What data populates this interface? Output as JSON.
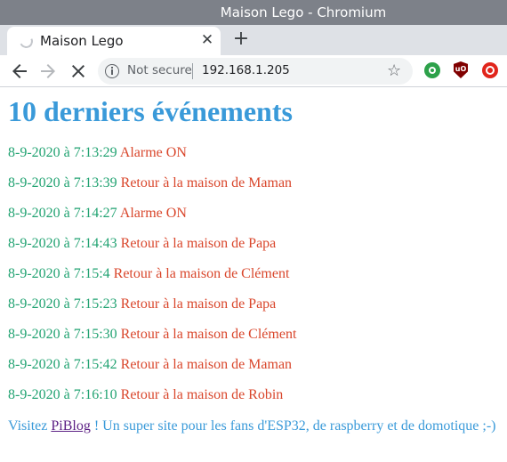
{
  "window": {
    "title": "Maison Lego - Chromium"
  },
  "tab": {
    "title": "Maison Lego",
    "close_glyph": "✕",
    "new_tab_glyph": "+"
  },
  "toolbar": {
    "back_icon": "arrow-left-icon",
    "forward_icon": "arrow-right-icon",
    "stop_icon": "stop-icon",
    "security_label": "Not secure",
    "url": "192.168.1.205",
    "bookmark_glyph": "☆",
    "extensions": [
      "green-circle-extension",
      "ublock-origin-extension",
      "red-circle-extension"
    ]
  },
  "page": {
    "title": "10 derniers événements",
    "events": [
      {
        "timestamp": "8-9-2020 à 7:13:29",
        "message": "Alarme ON"
      },
      {
        "timestamp": "8-9-2020 à 7:13:39",
        "message": "Retour à la maison de Maman"
      },
      {
        "timestamp": "8-9-2020 à 7:14:27",
        "message": "Alarme ON"
      },
      {
        "timestamp": "8-9-2020 à 7:14:43",
        "message": "Retour à la maison de Papa"
      },
      {
        "timestamp": "8-9-2020 à 7:15:4",
        "message": "Retour à la maison de Clément"
      },
      {
        "timestamp": "8-9-2020 à 7:15:23",
        "message": "Retour à la maison de Papa"
      },
      {
        "timestamp": "8-9-2020 à 7:15:30",
        "message": "Retour à la maison de Clément"
      },
      {
        "timestamp": "8-9-2020 à 7:15:42",
        "message": "Retour à la maison de Maman"
      },
      {
        "timestamp": "8-9-2020 à 7:16:10",
        "message": "Retour à la maison de Robin"
      }
    ],
    "footer": {
      "prefix": "Visitez ",
      "link_text": "PiBlog",
      "suffix": " ! Un super site pour les fans d'ESP32, de raspberry et de domotique ;-)"
    }
  },
  "colors": {
    "titlebar": "#7d8189",
    "heading": "#3a9ad9",
    "timestamp": "#22a372",
    "message": "#d9462b",
    "link": "#5b1f84"
  }
}
